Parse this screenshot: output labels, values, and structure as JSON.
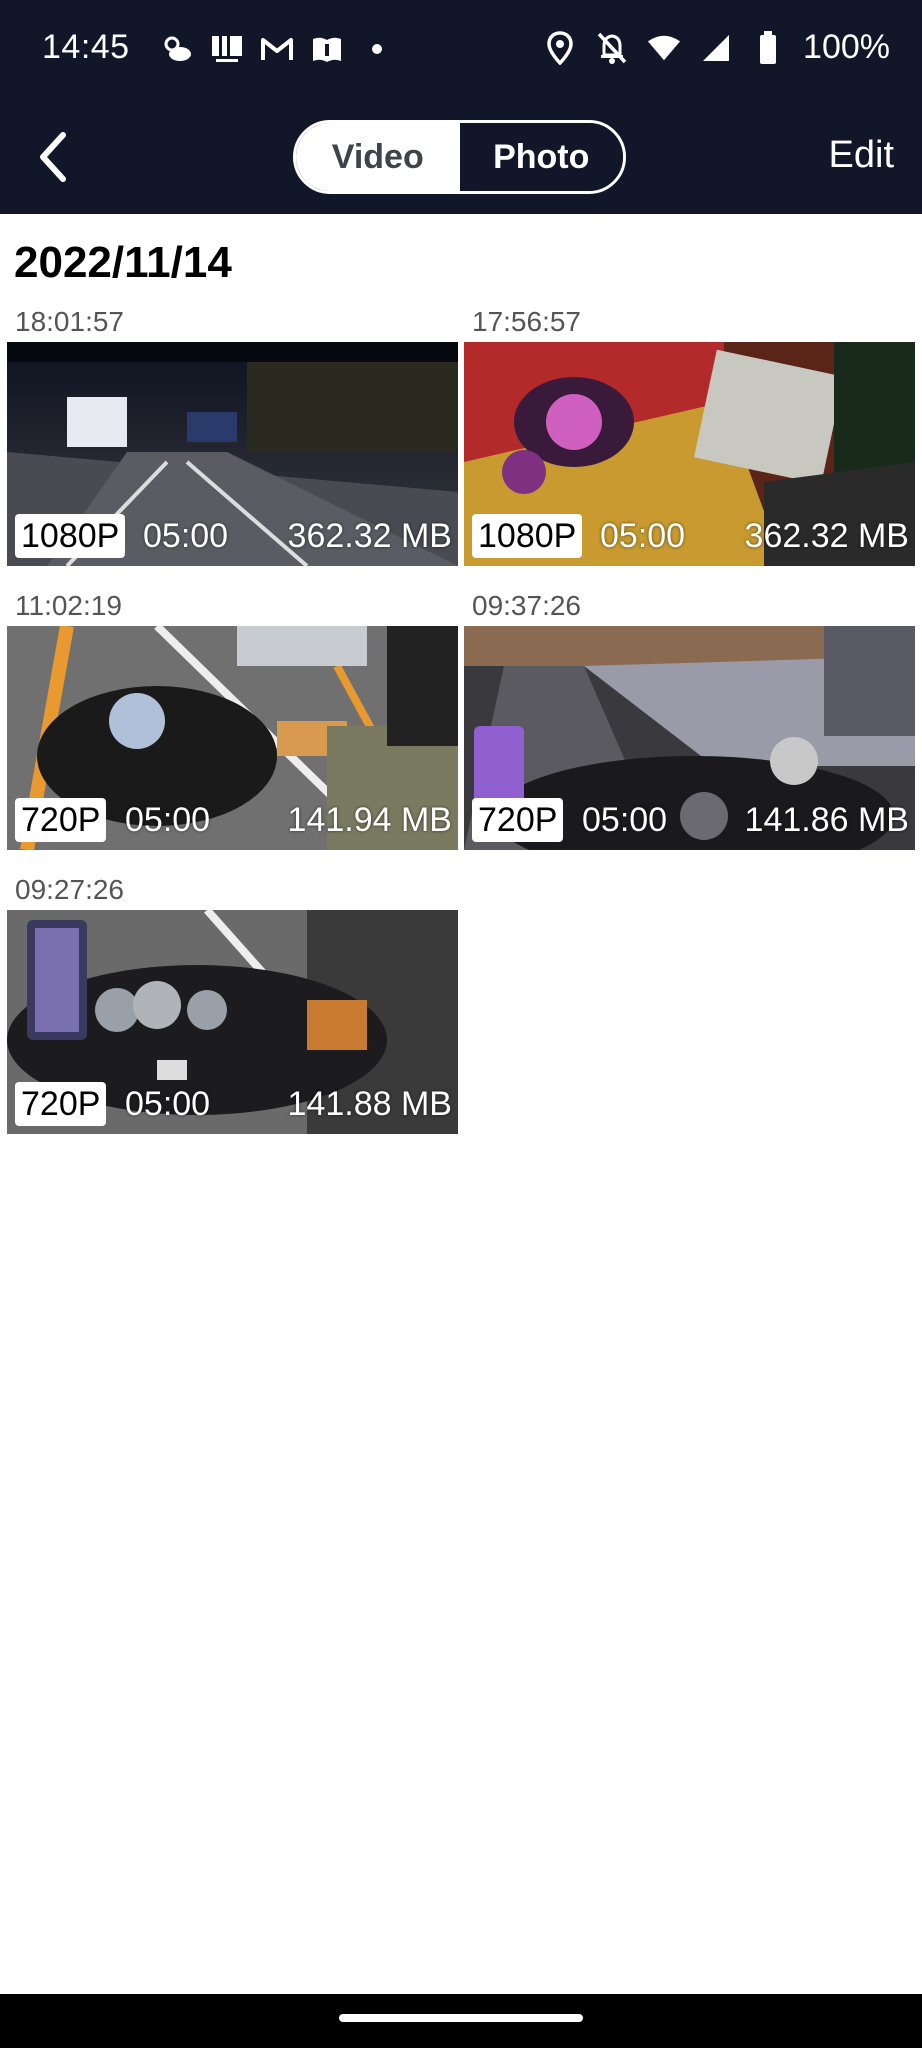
{
  "status_bar": {
    "time": "14:45",
    "battery": "100%",
    "icons_left": [
      "weather-icon",
      "rakuma-icon",
      "gmail-icon",
      "book-icon",
      "dot-icon"
    ],
    "icons_right": [
      "location-icon",
      "bell-off-icon",
      "wifi-icon",
      "signal-icon",
      "battery-icon"
    ]
  },
  "nav": {
    "back_icon": "chevron-left-icon",
    "tabs": [
      {
        "label": "Video",
        "active": true
      },
      {
        "label": "Photo",
        "active": false
      }
    ],
    "edit_label": "Edit"
  },
  "gallery": {
    "date": "2022/11/14",
    "items": [
      {
        "time": "18:01:57",
        "resolution": "1080P",
        "duration": "05:00",
        "size": "362.32 MB",
        "scene": "night-road"
      },
      {
        "time": "17:56:57",
        "resolution": "1080P",
        "duration": "05:00",
        "size": "362.32 MB",
        "scene": "gauges-close"
      },
      {
        "time": "11:02:19",
        "resolution": "720P",
        "duration": "05:00",
        "size": "141.94 MB",
        "scene": "scooter-day"
      },
      {
        "time": "09:37:26",
        "resolution": "720P",
        "duration": "05:00",
        "size": "141.86 MB",
        "scene": "tunnel-road"
      },
      {
        "time": "09:27:26",
        "resolution": "720P",
        "duration": "05:00",
        "size": "141.88 MB",
        "scene": "dashboard-phone"
      }
    ]
  },
  "colors": {
    "header_bg": "#121629",
    "page_bg": "#ffffff"
  }
}
